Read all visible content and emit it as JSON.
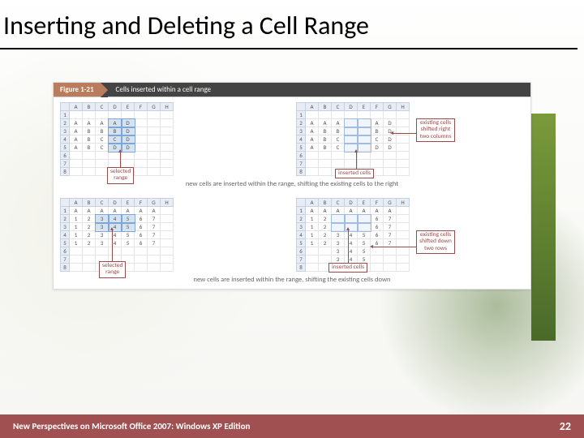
{
  "title": "Inserting and Deleting a Cell Range",
  "figure": {
    "number": "Figure 1-21",
    "title": "Cells inserted within a cell range",
    "callouts": {
      "selected_range": "selected\nrange",
      "inserted_cells": "inserted cells",
      "shift_right": "existing cells shifted right two columns",
      "shift_down": "existing cells shifted down two rows"
    },
    "caption_right": "new cells are inserted within the range, shifting the existing cells to the right",
    "caption_down": "new cells are inserted within the range, shifting the existing cells down",
    "columns": [
      "A",
      "B",
      "C",
      "D",
      "E",
      "F",
      "G",
      "H"
    ],
    "rows": [
      "1",
      "2",
      "3",
      "4",
      "5",
      "6",
      "7",
      "8"
    ],
    "data_letters": [
      "A",
      "B",
      "C",
      "D"
    ],
    "data_numbers": [
      "1",
      "2",
      "3",
      "4",
      "5",
      "6",
      "7"
    ]
  },
  "footer": {
    "left": "New Perspectives on Microsoft Office 2007: Windows XP Edition",
    "page": "22"
  }
}
